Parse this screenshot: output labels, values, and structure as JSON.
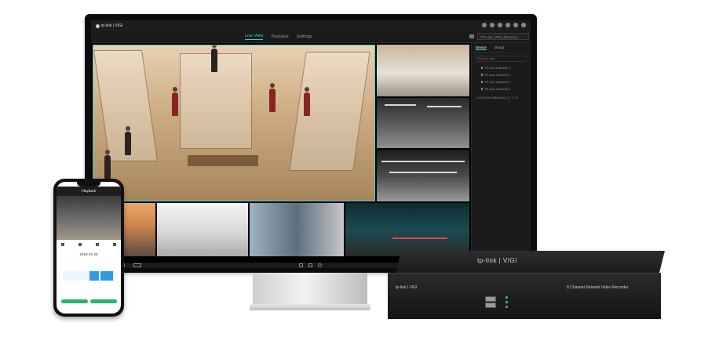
{
  "app": {
    "brand": "tp-link | VIGI",
    "nav_tabs": [
      {
        "label": "Live View",
        "active": true
      },
      {
        "label": "Playback",
        "active": false
      },
      {
        "label": "Settings",
        "active": false
      }
    ],
    "device_select": "TP-Link_VIGI_Demo(1)"
  },
  "sidebar": {
    "tabs": [
      {
        "label": "Device",
        "active": true
      },
      {
        "label": "Group",
        "active": false
      }
    ],
    "search_placeholder": "Search Item",
    "cameras": [
      "TP-Link Camera 1",
      "TP-Link Camera 2",
      "TP-Link Camera 3",
      "TP-Link Camera 4"
    ],
    "nvr": "VIGI NVR1008H(UN) 1.0 · 0 / 8"
  },
  "phone": {
    "header_title": "Playback",
    "date": "2019-10-25"
  },
  "nvr_box": {
    "top_logo": "tp-link | VIGI",
    "front_logo": "tp-link | VIGI",
    "model_text": "8 Channel Network Video Recorder"
  },
  "colors": {
    "accent": "#3fd0d6",
    "screen_bg": "#151515",
    "timeline_bar": "#2f9be0",
    "phone_button": "#28b36b",
    "led": "#3bd26a"
  }
}
